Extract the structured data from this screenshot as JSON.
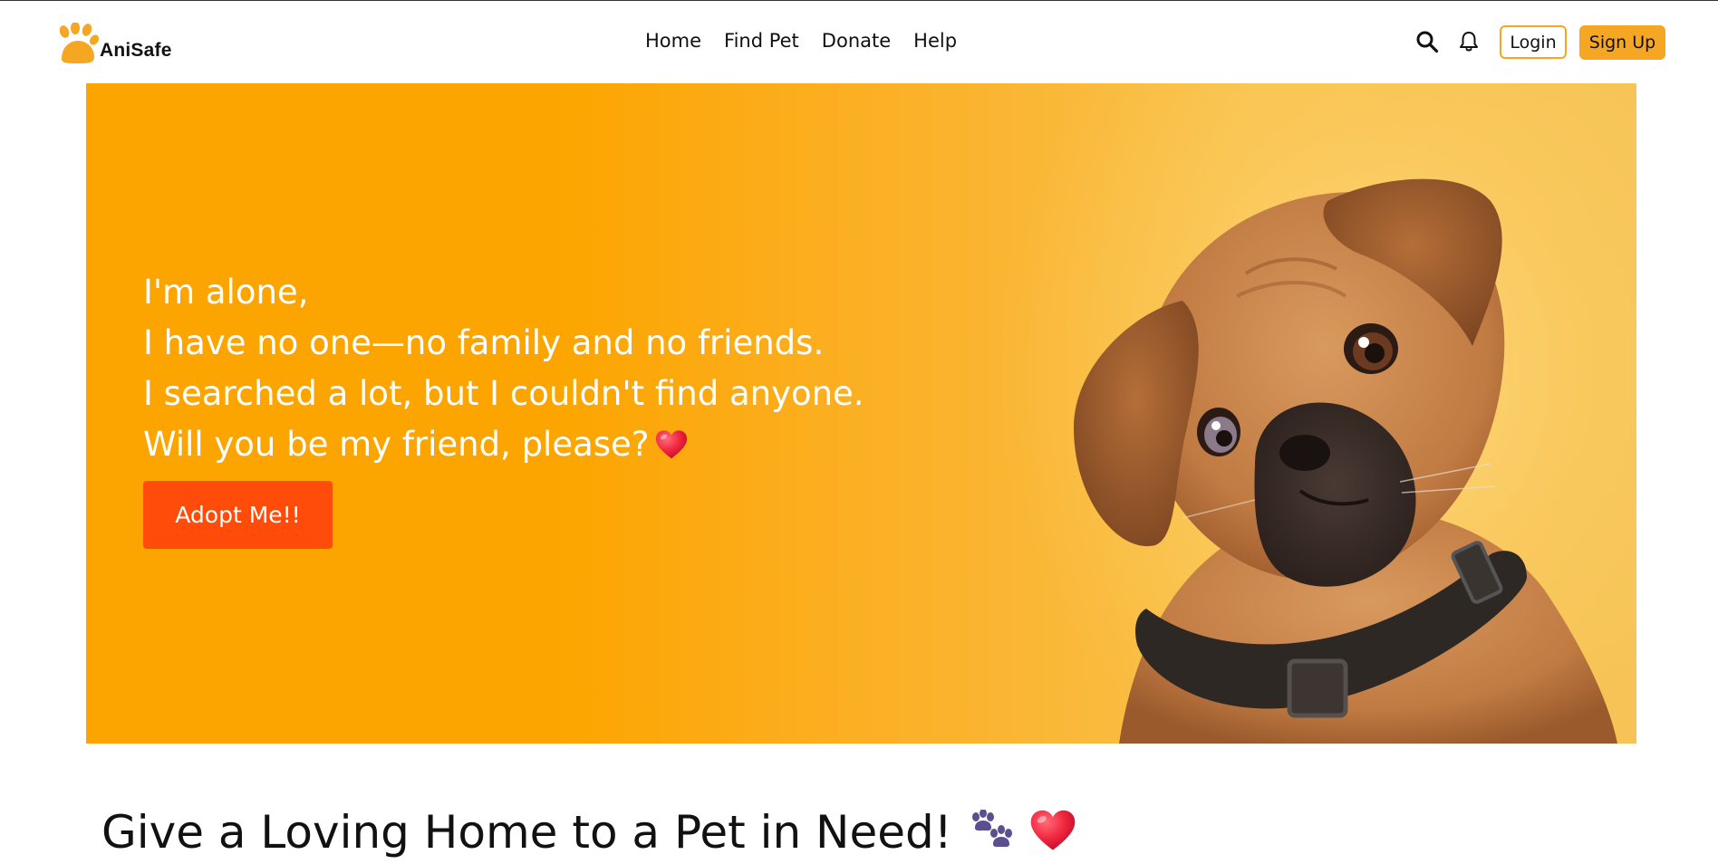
{
  "brand": {
    "name": "AniSafe",
    "logo_icon": "paw-icon",
    "accent": "#f5a623"
  },
  "nav": {
    "items": [
      "Home",
      "Find Pet",
      "Donate",
      "Help"
    ]
  },
  "header_tools": {
    "search_icon": "search-icon",
    "bell_icon": "bell-icon",
    "login_label": "Login",
    "signup_label": "Sign Up"
  },
  "hero": {
    "lines": [
      "I'm alone,",
      "I have no one—no family and no friends.",
      "I searched a lot, but I couldn't find anyone.",
      "Will you be my friend, please?"
    ],
    "line_end_icon": "heart-icon",
    "cta_label": "Adopt Me!!",
    "cta_color": "#ff4c0a",
    "background_color": "#fca500",
    "image": "puppy-photo"
  },
  "section": {
    "headline": "Give a Loving Home to a Pet in Need!",
    "headline_icons": [
      "paws-icon",
      "heart-icon"
    ]
  }
}
